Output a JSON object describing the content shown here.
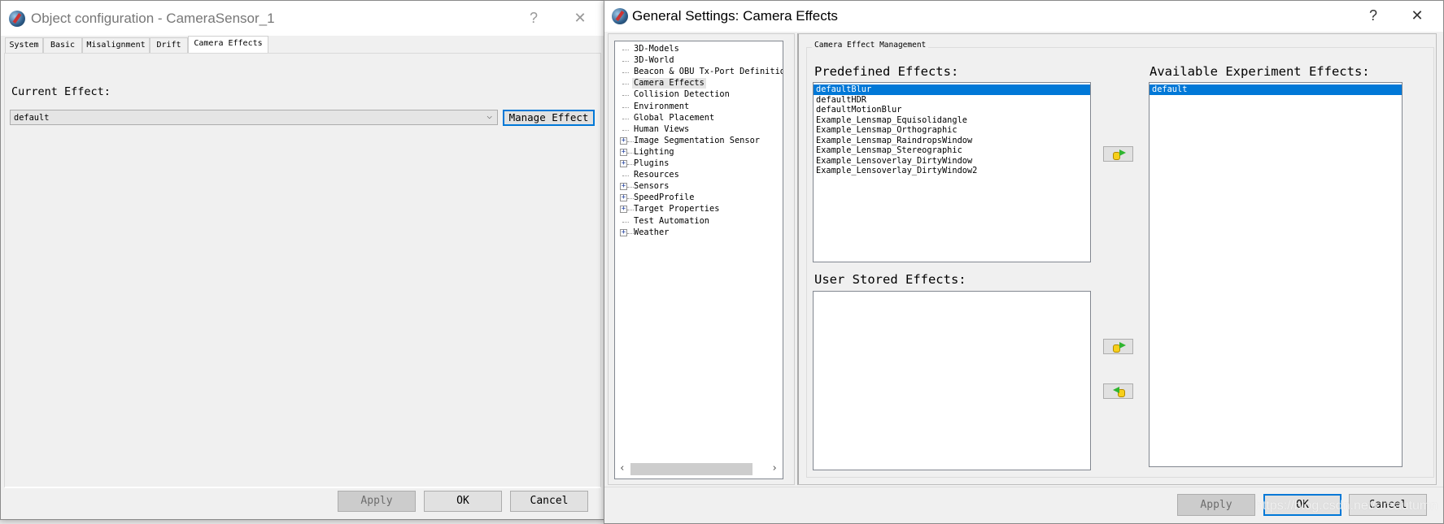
{
  "left_dialog": {
    "title": "Object configuration - CameraSensor_1",
    "help": "?",
    "close": "✕",
    "tabs": [
      "System",
      "Basic",
      "Misalignment",
      "Drift",
      "Camera Effects"
    ],
    "active_tab": "Camera Effects",
    "current_effect_label": "Current Effect:",
    "current_effect_value": "default",
    "manage_effect_button": "Manage Effect",
    "buttons": {
      "apply": "Apply",
      "ok": "OK",
      "cancel": "Cancel"
    }
  },
  "right_dialog": {
    "title": "General Settings: Camera Effects",
    "help": "?",
    "close": "✕",
    "tree": [
      {
        "label": "3D-Models",
        "expandable": false
      },
      {
        "label": "3D-World",
        "expandable": false
      },
      {
        "label": "Beacon & OBU Tx-Port Definitio",
        "expandable": false
      },
      {
        "label": "Camera Effects",
        "expandable": false,
        "selected": true
      },
      {
        "label": "Collision Detection",
        "expandable": false
      },
      {
        "label": "Environment",
        "expandable": false
      },
      {
        "label": "Global Placement",
        "expandable": false
      },
      {
        "label": "Human Views",
        "expandable": false
      },
      {
        "label": "Image Segmentation Sensor",
        "expandable": true
      },
      {
        "label": "Lighting",
        "expandable": true
      },
      {
        "label": "Plugins",
        "expandable": true
      },
      {
        "label": "Resources",
        "expandable": false
      },
      {
        "label": "Sensors",
        "expandable": true
      },
      {
        "label": "SpeedProfile",
        "expandable": true
      },
      {
        "label": "Target Properties",
        "expandable": true
      },
      {
        "label": "Test Automation",
        "expandable": false
      },
      {
        "label": "Weather",
        "expandable": true
      }
    ],
    "group_title": "Camera Effect Management",
    "predefined_label": "Predefined Effects:",
    "predefined_effects": [
      "defaultBlur",
      "defaultHDR",
      "defaultMotionBlur",
      "Example_Lensmap_Equisolidangle",
      "Example_Lensmap_Orthographic",
      "Example_Lensmap_RaindropsWindow",
      "Example_Lensmap_Stereographic",
      "Example_Lensoverlay_DirtyWindow",
      "Example_Lensoverlay_DirtyWindow2"
    ],
    "predefined_selected": "defaultBlur",
    "user_stored_label": "User Stored Effects:",
    "user_stored_effects": [],
    "available_label": "Available Experiment Effects:",
    "available_effects": [
      "default"
    ],
    "available_selected": "default",
    "buttons": {
      "apply": "Apply",
      "ok": "OK",
      "cancel": "Cancel"
    },
    "watermark": "https://blog.csdn.net/dreautumn"
  },
  "colors": {
    "selection": "#0078d7",
    "default_button_border": "#0078d7"
  }
}
